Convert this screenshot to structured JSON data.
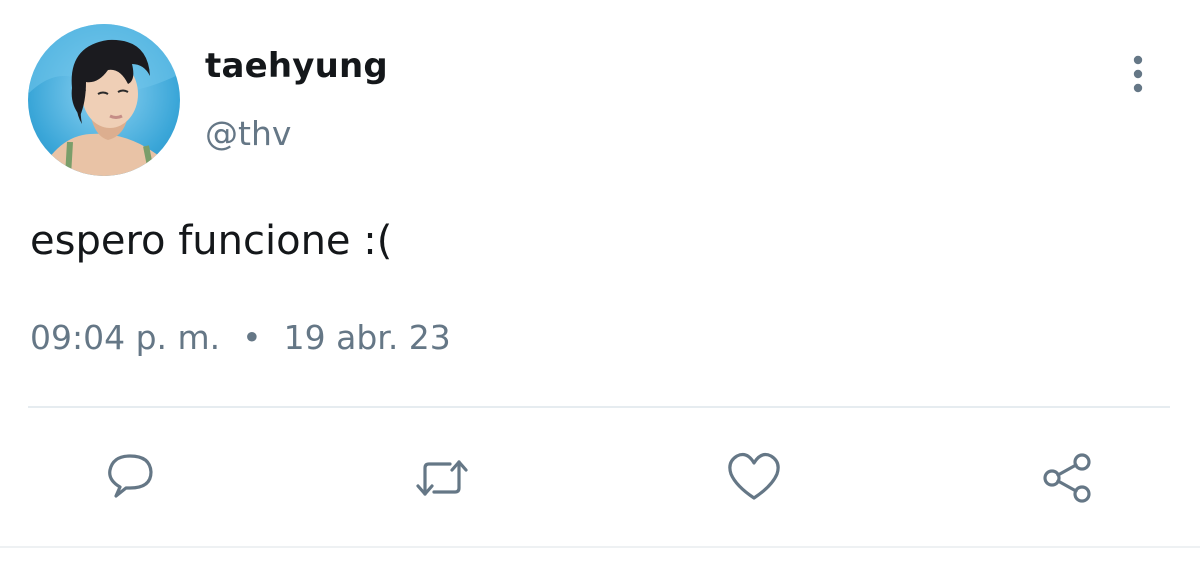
{
  "tweet": {
    "display_name": "taehyung",
    "handle": "@thv",
    "text": "espero funcione :(",
    "time": "09:04 p. m.",
    "separator": "•",
    "date": "19 abr. 23"
  },
  "icons": {
    "more": "more-vertical-icon",
    "reply": "reply-icon",
    "retweet": "retweet-icon",
    "like": "heart-icon",
    "share": "share-icon"
  },
  "colors": {
    "text": "#14171a",
    "secondary": "#657786",
    "divider": "#e6ecf0"
  }
}
